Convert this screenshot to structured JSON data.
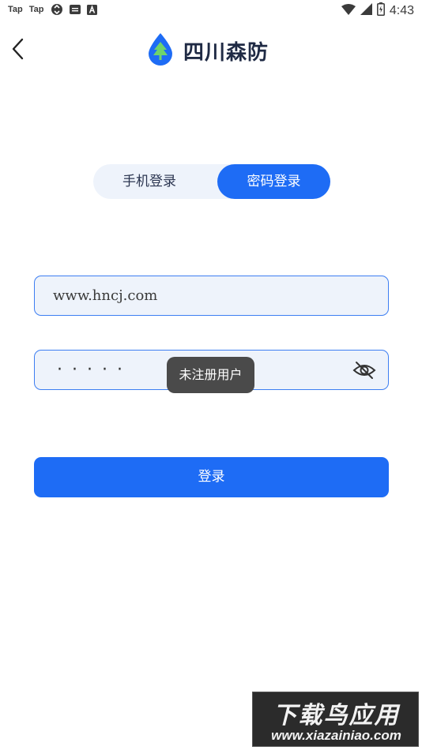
{
  "status_bar": {
    "left_labels": [
      "Tap",
      "Tap"
    ],
    "time": "4:43",
    "icons": [
      "taptap-icon",
      "taptap-icon",
      "sync-icon",
      "message-icon",
      "a-icon",
      "wifi-icon",
      "signal-icon",
      "battery-icon"
    ]
  },
  "header": {
    "title": "四川森防",
    "logo": "tree-drop-logo"
  },
  "tabs": {
    "phone_label": "手机登录",
    "password_label": "密码登录",
    "active": "password"
  },
  "form": {
    "username_value": "www.hncj.com",
    "password_masked": "·····"
  },
  "toast": {
    "message": "未注册用户"
  },
  "login_button": {
    "label": "登录"
  },
  "watermark": {
    "top_text": "下载鸟应用",
    "bottom_text": "www.xiazainiao.com"
  },
  "colors": {
    "primary": "#1e6cf5",
    "field_bg": "#eef3fb",
    "field_border": "#3d7ef2",
    "title": "#1f2a44",
    "toast_bg": "#4a4a4a"
  }
}
